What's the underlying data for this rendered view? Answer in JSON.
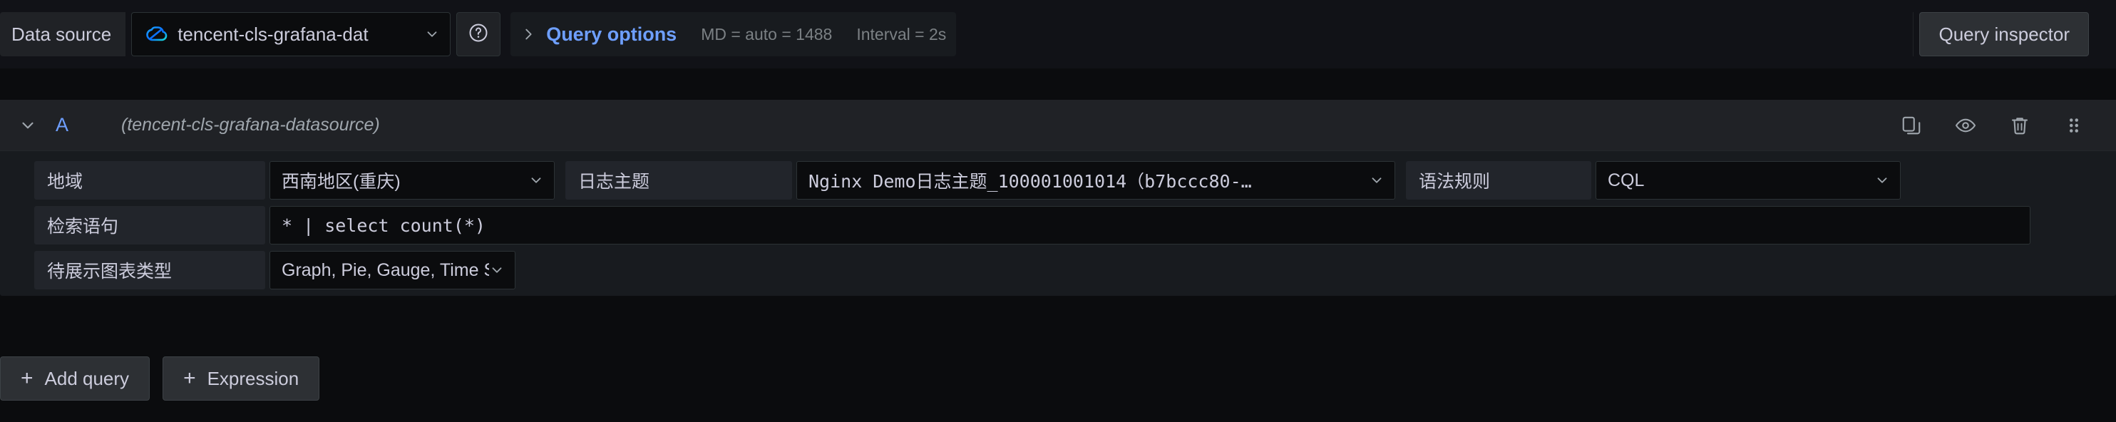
{
  "colors": {
    "page_bg": "#0b0c0e",
    "panel_bg": "#181b1f",
    "row_header_bg": "#202226",
    "label_bg": "#22252b",
    "input_bg": "#0b0c0e",
    "border": "#2c3235",
    "text_primary": "#ccccdc",
    "text_secondary": "#9fa6ad",
    "text_muted": "#7b8084",
    "accent_blue": "#6e9fff",
    "brand_cyan": "#00a3ff"
  },
  "datasource_bar": {
    "label": "Data source",
    "picker_value": "tencent-cls-grafana-dat",
    "picker_icon": "tencent-cloud-logo-icon",
    "help_icon": "question-circle-icon",
    "query_options": {
      "caret_icon": "chevron-right-icon",
      "link_label": "Query options",
      "max_data_points": "MD = auto = 1488",
      "interval": "Interval = 2s"
    },
    "query_inspector_label": "Query inspector"
  },
  "query_row": {
    "collapse_icon": "chevron-down-icon",
    "ref_id": "A",
    "datasource_name": "(tencent-cls-grafana-datasource)",
    "actions": [
      {
        "name": "duplicate-query-icon",
        "title": "Duplicate query"
      },
      {
        "name": "eye-icon",
        "title": "Disable/enable query"
      },
      {
        "name": "trash-icon",
        "title": "Remove query"
      },
      {
        "name": "drag-handle-icon",
        "title": "Drag to reorder"
      }
    ]
  },
  "form": {
    "rows": [
      {
        "fields": [
          {
            "label": "地域",
            "control": "select",
            "value": "西南地区(重庆)",
            "chevron_icon": "chevron-down-icon"
          },
          {
            "label": "日志主题",
            "control": "select",
            "value": "Nginx Demo日志主题_100001001014（b7bccc80-…",
            "chevron_icon": "chevron-down-icon"
          },
          {
            "label": "语法规则",
            "control": "select",
            "value": "CQL",
            "chevron_icon": "chevron-down-icon"
          }
        ]
      },
      {
        "fields": [
          {
            "label": "检索语句",
            "control": "text",
            "value": "* | select count(*)",
            "placeholder": ""
          }
        ]
      },
      {
        "fields": [
          {
            "label": "待展示图表类型",
            "control": "select",
            "value": "Graph, Pie, Gauge, Time Series Panel",
            "chevron_icon": "chevron-down-icon"
          }
        ]
      }
    ]
  },
  "footer": {
    "add_query_label": "Add query",
    "expression_label": "Expression",
    "plus_glyph": "+"
  }
}
